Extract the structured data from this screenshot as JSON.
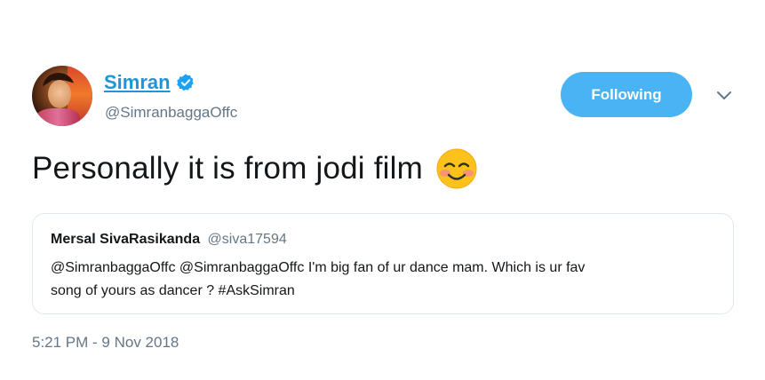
{
  "author": {
    "display_name": "Simran",
    "handle": "@SimranbaggaOffc",
    "verified": true,
    "avatar_icon": "profile-photo"
  },
  "actions": {
    "follow_label": "Following",
    "follow_color": "#4ab3f4",
    "more_icon": "chevron-down-icon"
  },
  "tweet": {
    "text": "Personally it is from jodi film",
    "emoji": "smiling-face-with-smiling-eyes"
  },
  "quoted_tweet": {
    "display_name": "Mersal SivaRasikanda",
    "handle": "@siva17594",
    "text_line1": "@SimranbaggaOffc @SimranbaggaOffc I'm big fan of ur dance mam. Which is ur fav",
    "text_line2": "song of yours as dancer ? #AskSimran"
  },
  "timestamp": "5:21 PM - 9 Nov 2018",
  "colors": {
    "link_blue": "#1b95e0",
    "secondary_gray": "#657786",
    "border": "#e1e8ed"
  }
}
